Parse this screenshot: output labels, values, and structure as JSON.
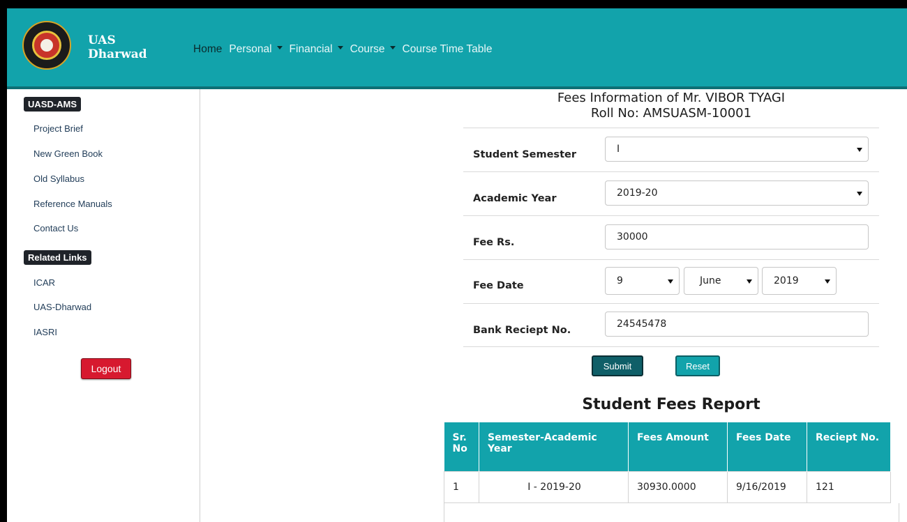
{
  "brand": {
    "line1": "UAS",
    "line2": "Dharwad"
  },
  "nav": {
    "home": "Home",
    "personal": "Personal",
    "financial": "Financial",
    "course": "Course",
    "timetable": "Course Time Table"
  },
  "sidebar": {
    "badge1": "UASD-AMS",
    "links": [
      "Project Brief",
      "New Green Book",
      "Old Syllabus",
      "Reference Manuals",
      "Contact Us"
    ],
    "badge2": "Related Links",
    "related": [
      "ICAR",
      "UAS-Dharwad",
      "IASRI"
    ],
    "logout": "Logout"
  },
  "form": {
    "title1": "Fees Information of Mr. VIBOR TYAGI",
    "title2": "Roll No: AMSUASM-10001",
    "semester_label": "Student Semester",
    "semester_value": "I",
    "year_label": "Academic Year",
    "year_value": "2019-20",
    "fee_label": "Fee Rs.",
    "fee_value": "30000",
    "date_label": "Fee Date",
    "day": "9",
    "month": "June",
    "year": "2019",
    "receipt_label": "Bank Reciept No.",
    "receipt_value": "24545478",
    "submit": "Submit",
    "reset": "Reset"
  },
  "report": {
    "title": "Student Fees Report",
    "headers": [
      "Sr.\nNo",
      "Semester-Academic Year",
      "Fees Amount",
      "Fees Date",
      "Reciept No."
    ],
    "rows": [
      [
        "1",
        "I - 2019-20",
        "30930.0000",
        "9/16/2019",
        "121"
      ]
    ]
  },
  "colors": {
    "teal": "#12a3ab",
    "dark_teal": "#0f5f68",
    "logout_red": "#d7192f"
  }
}
